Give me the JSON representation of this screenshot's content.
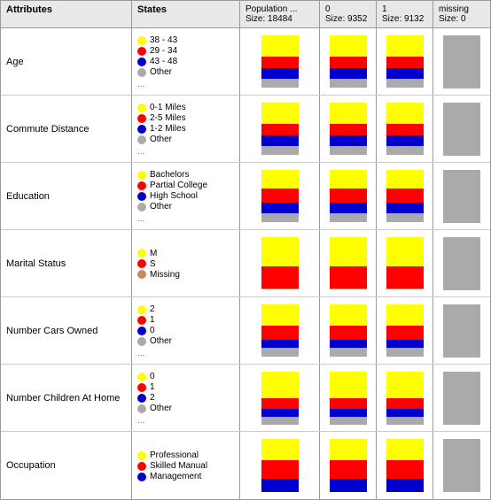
{
  "header": {
    "col_attr": "Attributes",
    "col_states": "States",
    "col_pop_label": "Population ...",
    "col_pop_size": "Size: 18484",
    "col_0_label": "0",
    "col_0_size": "Size: 9352",
    "col_1_label": "1",
    "col_1_size": "Size: 9132",
    "col_missing_label": "missing",
    "col_missing_size": "Size: 0"
  },
  "rows": [
    {
      "attr": "Age",
      "legend": [
        {
          "color": "#ffff00",
          "label": "38 - 43"
        },
        {
          "color": "#ff0000",
          "label": "29 - 34"
        },
        {
          "color": "#0000cc",
          "label": "43 - 48"
        },
        {
          "color": "#aaaaaa",
          "label": "Other"
        }
      ],
      "has_more": true,
      "charts": {
        "pop": [
          40,
          22,
          20,
          18
        ],
        "zero": [
          40,
          22,
          20,
          18
        ],
        "one": [
          40,
          22,
          20,
          18
        ],
        "missing": null
      }
    },
    {
      "attr": "Commute Distance",
      "legend": [
        {
          "color": "#ffff00",
          "label": "0-1 Miles"
        },
        {
          "color": "#ff0000",
          "label": "2-5 Miles"
        },
        {
          "color": "#0000cc",
          "label": "1-2 Miles"
        },
        {
          "color": "#aaaaaa",
          "label": "Other"
        }
      ],
      "has_more": true,
      "charts": {
        "pop": [
          40,
          22,
          20,
          18
        ],
        "zero": [
          40,
          22,
          20,
          18
        ],
        "one": [
          40,
          22,
          20,
          18
        ],
        "missing": null
      }
    },
    {
      "attr": "Education",
      "legend": [
        {
          "color": "#ffff00",
          "label": "Bachelors"
        },
        {
          "color": "#ff0000",
          "label": "Partial College"
        },
        {
          "color": "#0000cc",
          "label": "High School"
        },
        {
          "color": "#aaaaaa",
          "label": "Other"
        }
      ],
      "has_more": true,
      "charts": {
        "pop": [
          35,
          28,
          20,
          17
        ],
        "zero": [
          35,
          28,
          20,
          17
        ],
        "one": [
          35,
          28,
          20,
          17
        ],
        "missing": null
      }
    },
    {
      "attr": "Marital Status",
      "legend": [
        {
          "color": "#ffff00",
          "label": "M"
        },
        {
          "color": "#ff0000",
          "label": "S"
        },
        {
          "color": "#cc8866",
          "label": "Missing"
        }
      ],
      "has_more": false,
      "charts": {
        "pop": [
          55,
          43,
          2
        ],
        "zero": [
          55,
          43,
          2
        ],
        "one": [
          55,
          43,
          2
        ],
        "missing": null
      }
    },
    {
      "attr": "Number Cars Owned",
      "legend": [
        {
          "color": "#ffff00",
          "label": "2"
        },
        {
          "color": "#ff0000",
          "label": "1"
        },
        {
          "color": "#0000cc",
          "label": "0"
        },
        {
          "color": "#aaaaaa",
          "label": "Other"
        }
      ],
      "has_more": true,
      "charts": {
        "pop": [
          40,
          28,
          15,
          17
        ],
        "zero": [
          40,
          28,
          15,
          17
        ],
        "one": [
          40,
          28,
          15,
          17
        ],
        "missing": null
      }
    },
    {
      "attr": "Number Children At Home",
      "legend": [
        {
          "color": "#ffff00",
          "label": "0"
        },
        {
          "color": "#ff0000",
          "label": "1"
        },
        {
          "color": "#0000cc",
          "label": "2"
        },
        {
          "color": "#aaaaaa",
          "label": "Other"
        }
      ],
      "has_more": true,
      "charts": {
        "pop": [
          50,
          20,
          15,
          15
        ],
        "zero": [
          50,
          20,
          15,
          15
        ],
        "one": [
          50,
          20,
          15,
          15
        ],
        "missing": null
      }
    },
    {
      "attr": "Occupation",
      "legend": [
        {
          "color": "#ffff00",
          "label": "Professional"
        },
        {
          "color": "#ff0000",
          "label": "Skilled Manual"
        },
        {
          "color": "#0000cc",
          "label": "Management"
        }
      ],
      "has_more": false,
      "charts": {
        "pop": [
          40,
          35,
          25
        ],
        "zero": [
          40,
          35,
          25
        ],
        "one": [
          40,
          35,
          25
        ],
        "missing": null
      }
    }
  ],
  "colors": {
    "yellow": "#ffff00",
    "red": "#ff0000",
    "blue": "#0000cc",
    "gray": "#aaaaaa",
    "tan": "#cc8866"
  }
}
